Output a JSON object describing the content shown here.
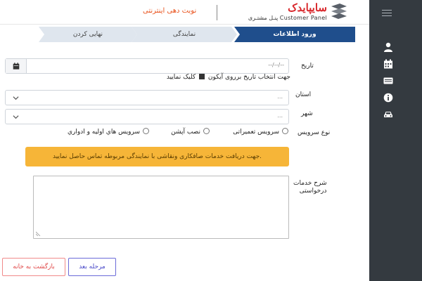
{
  "header": {
    "brand_name": "سایپایدک",
    "brand_sub": "پنـل مشتـری  Customer Panel",
    "online_title": "نوبت دهی اینترنتی"
  },
  "sidebar": {
    "icons": [
      "menu-icon",
      "user-icon",
      "calendar-icon",
      "id-card-icon",
      "info-icon",
      "car-icon"
    ]
  },
  "steps": [
    {
      "label": "ورود اطلاعات",
      "active": true
    },
    {
      "label": "نمایندگی",
      "active": false
    },
    {
      "label": "نهایی کردن",
      "active": false
    }
  ],
  "form": {
    "date_label": "تاریخ",
    "date_placeholder": "--/--/--",
    "date_hint_before": "جهت انتخاب تاریخ برروی آیکون",
    "date_hint_after": "کلیک نمایید",
    "province_label": "استان",
    "province_value": "...",
    "city_label": "شهر",
    "city_value": "...",
    "service_type_label": "نوع سرویس",
    "service_options": [
      "سرویس تعمیراتی",
      "نصب آپشن",
      "سرویس هاي اولیه و ادواري"
    ],
    "alert_text": "جهت دریافت خدمات صافکاری ونقاشی با نمایندگی مربوطه تماس حاصل نمایید.",
    "description_label_line1": "شرح خدمات",
    "description_label_line2": "درخواستی"
  },
  "buttons": {
    "next": "مرحله بعد",
    "home": "بازگشت به خانه"
  },
  "colors": {
    "brand_red": "#d8262a",
    "accent_orange": "#e9541f",
    "step_active": "#1f4e8c",
    "step_inactive": "#dfe6ee",
    "alert": "#f6b538",
    "sidebar": "#343a40"
  }
}
